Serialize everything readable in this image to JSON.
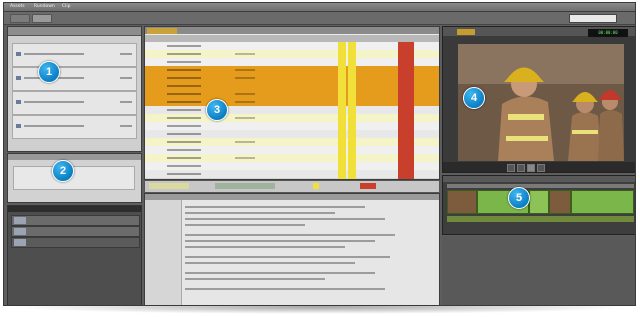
{
  "menu": {
    "items": [
      "Assets",
      "Rundown",
      "Clip"
    ]
  },
  "viewer": {
    "timecode": "00:00:00"
  },
  "callouts": [
    "1",
    "2",
    "3",
    "4",
    "5"
  ],
  "colors": {
    "accent_orange": "#e59b1c",
    "highlight_yellow": "#f2e03a",
    "alert_red": "#c8402c",
    "callout_blue": "#0a7fc4",
    "clip_green": "#7bb64b"
  },
  "icons": [
    "play-icon",
    "rewind-icon",
    "fast-forward-icon",
    "stop-icon"
  ]
}
